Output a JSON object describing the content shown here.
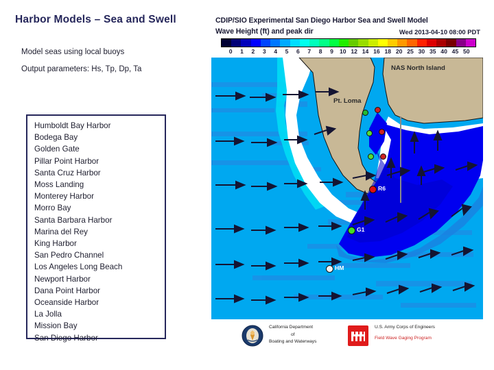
{
  "slide": {
    "title": "Harbor Models – Sea and Swell",
    "bullets": [
      "Model seas using local buoys",
      "Output parameters: Hs, Tp, Dp, Ta"
    ],
    "harbor_list": [
      "Humboldt Bay Harbor",
      "Bodega Bay",
      "Golden Gate",
      "Pillar Point Harbor",
      "Santa Cruz Harbor",
      "Moss Landing",
      "Monterey Harbor",
      "Morro Bay",
      "Santa Barbara Harbor",
      "Marina del Rey",
      "King Harbor",
      "San Pedro Channel",
      "Los Angeles Long Beach",
      "Newport Harbor",
      "Dana Point Harbor",
      "Oceanside Harbor",
      "La Jolla",
      "Mission Bay",
      "San Diego Harbor"
    ],
    "colors": {
      "title": "#26275b",
      "box_border": "#26275b",
      "text": "#1d1d2e"
    }
  },
  "map": {
    "title": "CDIP/SIO Experimental San Diego Harbor Sea and Swell Model",
    "subtitle": "Wave Height (ft) and peak dir",
    "timestamp": "Wed 2013-04-10 08:00 PDT",
    "colorbar": {
      "tick_labels": [
        "0",
        "1",
        "2",
        "3",
        "4",
        "5",
        "6",
        "7",
        "8",
        "9",
        "10",
        "12",
        "14",
        "16",
        "18",
        "20",
        "25",
        "30",
        "35",
        "40",
        "45",
        "50"
      ],
      "colors": [
        "#000033",
        "#000077",
        "#0000bb",
        "#0000ff",
        "#0044ff",
        "#0077ff",
        "#00aaff",
        "#00ddff",
        "#00ffee",
        "#00ffbb",
        "#00ff88",
        "#00ff44",
        "#22ee00",
        "#66cc00",
        "#99dd00",
        "#ccee00",
        "#ffff00",
        "#ffcc00",
        "#ff9900",
        "#ff6600",
        "#ff2200",
        "#dd0000",
        "#aa0000",
        "#770000",
        "#880088",
        "#cc00cc"
      ]
    },
    "land_labels": [
      {
        "name": "pt-loma",
        "text": "Pt. Loma"
      },
      {
        "name": "nas-north-island",
        "text": "NAS North Island"
      }
    ],
    "stations": [
      {
        "name": "station-r6",
        "label": "R6",
        "color": "#e01010"
      },
      {
        "name": "station-g1",
        "label": "G1",
        "color": "#44dd22"
      },
      {
        "name": "station-hm",
        "label": "HM",
        "color": "#f2f2f2"
      }
    ],
    "colors": {
      "ocean": "#00a8f0",
      "ocean_mid": "#1088e8",
      "ocean_deepblue": "#0000f0",
      "cyan_band": "#00e8f8",
      "land": "#c8b896",
      "shore_white": "#ffffff",
      "arrow": "#141432"
    },
    "footer": {
      "cdbw": {
        "line1": "California Department",
        "line2": "of",
        "line3": "Boating and Waterways"
      },
      "usace": {
        "line1": "U.S. Army Corps of Engineers",
        "line2": "Field Wave Gaging Program"
      }
    }
  }
}
